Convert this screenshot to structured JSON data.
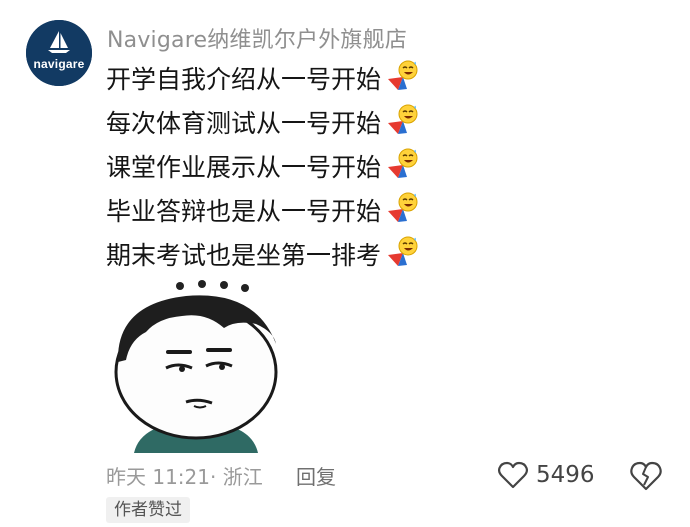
{
  "comment": {
    "username": "Navigare纳维凯尔户外旗舰店",
    "avatar_text": "navigare",
    "lines": [
      "开学自我介绍从一号开始",
      "每次体育测试从一号开始",
      "课堂作业展示从一号开始",
      "毕业答辩也是从一号开始",
      "期末考试也是坐第一排考"
    ],
    "line_emoji": "sweat-laugh-emoji",
    "sticker": "awkward-panda-face-sticker",
    "timestamp": "昨天 11:21",
    "location": "浙江",
    "meta_separator": "·",
    "reply_label": "回复",
    "like_count": "5496",
    "badge": "作者赞过"
  },
  "colors": {
    "avatar_bg": "#123a63",
    "username": "#8f8f8f",
    "meta": "#9a9a9a",
    "badge_bg": "#f0f0f0"
  }
}
